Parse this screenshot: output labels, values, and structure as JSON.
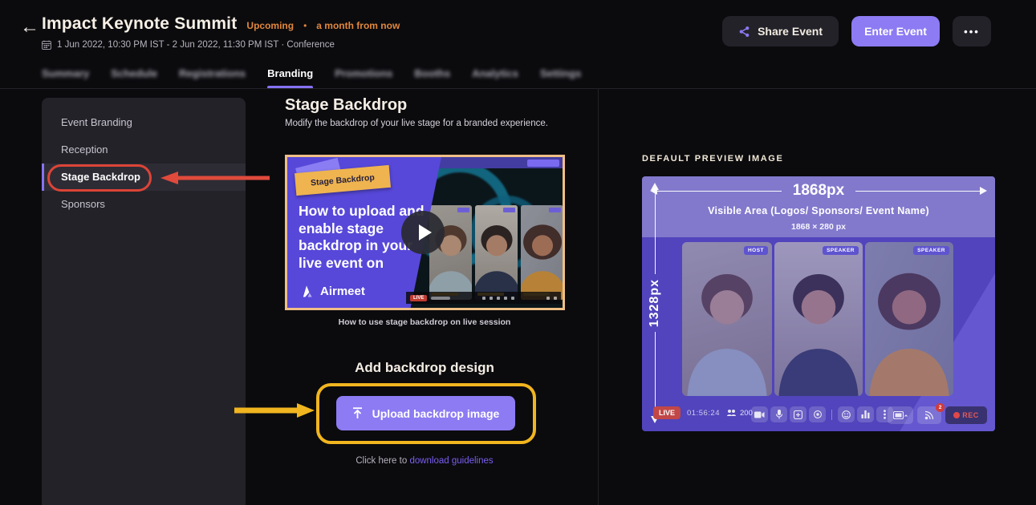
{
  "colors": {
    "accent_purple": "#8c7bf3",
    "status_orange": "#e1873c",
    "annotation_red": "#dc4437",
    "annotation_yellow": "#f1b51f",
    "link_purple": "#7b5ff0",
    "preview_purple": "#5144bc",
    "thumbnail_border": "#f0bf85"
  },
  "header": {
    "back_icon": "←",
    "title": "Impact Keynote Summit",
    "status": "Upcoming",
    "status_separator": "•",
    "time_until": "a month from now",
    "datetime": "1 Jun 2022, 10:30 PM IST - 2 Jun 2022, 11:30 PM IST · Conference",
    "share_button": "Share Event",
    "enter_button": "Enter Event",
    "more_button": "•••"
  },
  "tabs": [
    {
      "label": "Summary",
      "active": false
    },
    {
      "label": "Schedule",
      "active": false
    },
    {
      "label": "Registrations",
      "active": false
    },
    {
      "label": "Branding",
      "active": true
    },
    {
      "label": "Promotions",
      "active": false
    },
    {
      "label": "Booths",
      "active": false
    },
    {
      "label": "Analytics",
      "active": false
    },
    {
      "label": "Settings",
      "active": false
    }
  ],
  "sidebar": {
    "items": [
      {
        "label": "Event Branding",
        "active": false
      },
      {
        "label": "Reception",
        "active": false
      },
      {
        "label": "Stage Backdrop",
        "active": true
      },
      {
        "label": "Sponsors",
        "active": false
      }
    ]
  },
  "main": {
    "title": "Stage Backdrop",
    "subtitle": "Modify the backdrop of your live stage for a branded experience.",
    "video": {
      "sticker": "Stage Backdrop",
      "headline": "How to upload and enable stage backdrop in your live event on",
      "brand": "Airmeet",
      "live_badge": "LIVE",
      "caption": "How to use stage backdrop on live session"
    },
    "add_heading": "Add backdrop design",
    "upload_button": "Upload backdrop image",
    "guidelines_prefix": "Click here to ",
    "guidelines_link": "download guidelines"
  },
  "preview": {
    "section_title": "DEFAULT PREVIEW IMAGE",
    "width_label": "1868px",
    "height_label": "1328px",
    "visible_area_title": "Visible Area (Logos/ Sponsors/ Event Name)",
    "visible_area_size": "1868 × 280 px",
    "tiles": [
      {
        "badge": "HOST"
      },
      {
        "badge": "SPEAKER"
      },
      {
        "badge": "SPEAKER"
      }
    ],
    "controls": {
      "live_badge": "LIVE",
      "timer": "01:56:24",
      "viewers": "200",
      "stream_badge": "2",
      "rec_label": "REC"
    }
  }
}
